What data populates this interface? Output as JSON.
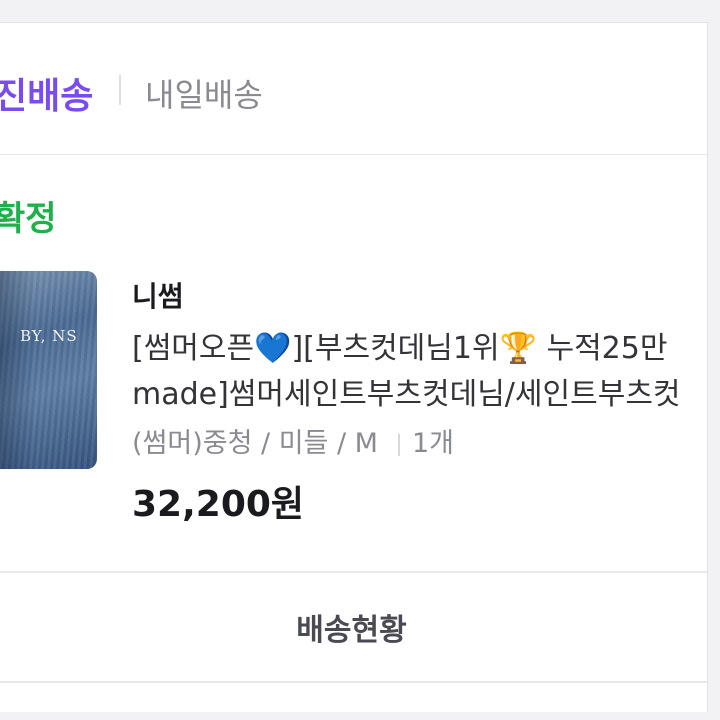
{
  "delivery_tabs": {
    "primary": "진배송",
    "secondary": "내일배송"
  },
  "order": {
    "status": "확정",
    "image_text": "BY, NS",
    "seller": "니썸",
    "title_line1_a": "[썸머오픈",
    "heart_emoji": "💙",
    "title_line1_b": "][부츠컷데님1위",
    "trophy_emoji": "🏆",
    "title_line1_c": " 누적25만",
    "title_line2": "made]썸머세인트부츠컷데님/세인트부츠컷",
    "options": "(썸머)중청 / 미들 / M",
    "quantity": "1개",
    "price": "32,200원"
  },
  "actions": {
    "track_label": "배송현황"
  },
  "colors": {
    "accent_purple": "#7a4cf0",
    "status_green": "#1fb04b"
  }
}
